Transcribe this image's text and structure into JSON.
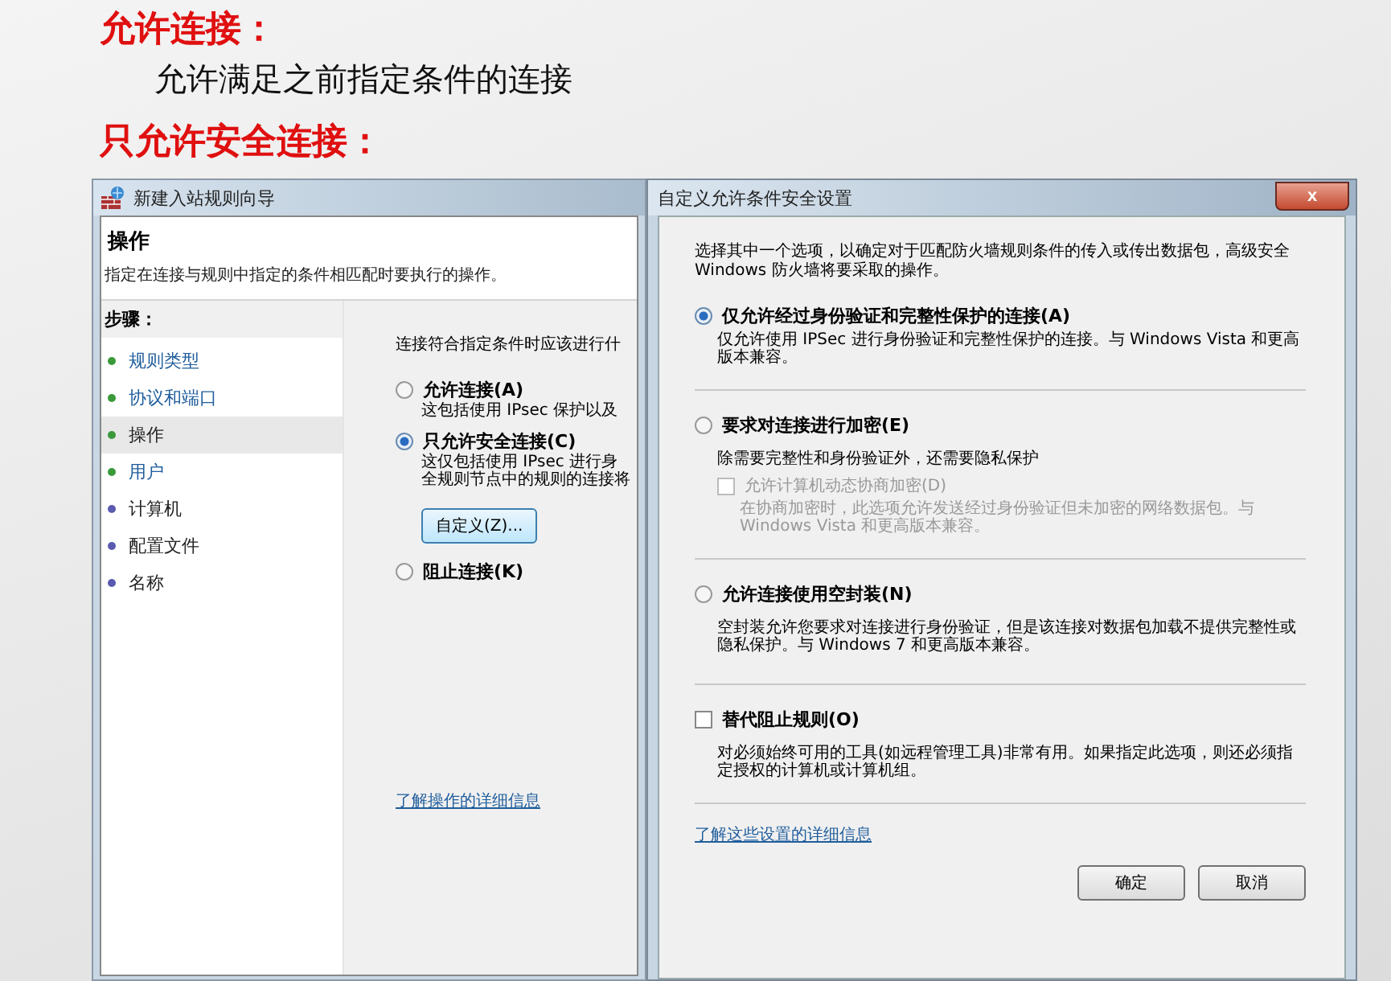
{
  "slide": {
    "headings": [
      {
        "kind": "heading",
        "text": "允许连接："
      },
      {
        "kind": "body",
        "text": "允许满足之前指定条件的连接"
      },
      {
        "kind": "heading",
        "text": "只允许安全连接："
      }
    ]
  },
  "wizard": {
    "title": "新建入站规则向导",
    "header": "操作",
    "subtitle": "指定在连接与规则中指定的条件相匹配时要执行的操作。",
    "steps_label": "步骤：",
    "steps": [
      {
        "label": "规则类型",
        "done": true,
        "selected": false
      },
      {
        "label": "协议和端口",
        "done": true,
        "selected": false
      },
      {
        "label": "操作",
        "done": true,
        "selected": true
      },
      {
        "label": "用户",
        "done": true,
        "selected": false
      },
      {
        "label": "计算机",
        "done": false,
        "selected": false
      },
      {
        "label": "配置文件",
        "done": false,
        "selected": false
      },
      {
        "label": "名称",
        "done": false,
        "selected": false
      }
    ],
    "prompt": "连接符合指定条件时应该进行什",
    "options": [
      {
        "label": "允许连接(A)",
        "description": "这包括使用 IPsec 保护以及",
        "selected": false
      },
      {
        "label": "只允许安全连接(C)",
        "description": [
          "这仅包括使用 IPsec 进行身",
          "全规则节点中的规则的连接将"
        ],
        "selected": true,
        "button": "自定义(Z)..."
      },
      {
        "label": "阻止连接(K)",
        "selected": false
      }
    ],
    "link": "了解操作的详细信息"
  },
  "dialog": {
    "title": "自定义允许条件安全设置",
    "close": "x",
    "intro": "选择其中一个选项，以确定对于匹配防火墙规则条件的传入或传出数据包，高级安全 Windows 防火墙将要采取的操作。",
    "options": [
      {
        "kind": "radio",
        "label": "仅允许经过身份验证和完整性保护的连接(A)",
        "description": "仅允许使用 IPSec 进行身份验证和完整性保护的连接。与 Windows Vista 和更高版本兼容。",
        "selected": true
      },
      {
        "kind": "radio",
        "label": "要求对连接进行加密(E)",
        "description": "除需要完整性和身份验证外，还需要隐私保护",
        "selected": false,
        "sub": {
          "label": "允许计算机动态协商加密(D)",
          "description": "在协商加密时，此选项允许发送经过身份验证但未加密的网络数据包。与 Windows Vista 和更高版本兼容。",
          "checked": false,
          "disabled": true
        }
      },
      {
        "kind": "radio",
        "label": "允许连接使用空封装(N)",
        "description": "空封装允许您要求对连接进行身份验证，但是该连接对数据包加载不提供完整性或隐私保护。与 Windows 7 和更高版本兼容。",
        "selected": false
      },
      {
        "kind": "checkbox",
        "label": "替代阻止规则(O)",
        "description": "对必须始终可用的工具(如远程管理工具)非常有用。如果指定此选项，则还必须指定授权的计算机或计算机组。",
        "checked": false
      }
    ],
    "link": "了解这些设置的详细信息",
    "buttons": [
      "确定",
      "取消"
    ]
  }
}
